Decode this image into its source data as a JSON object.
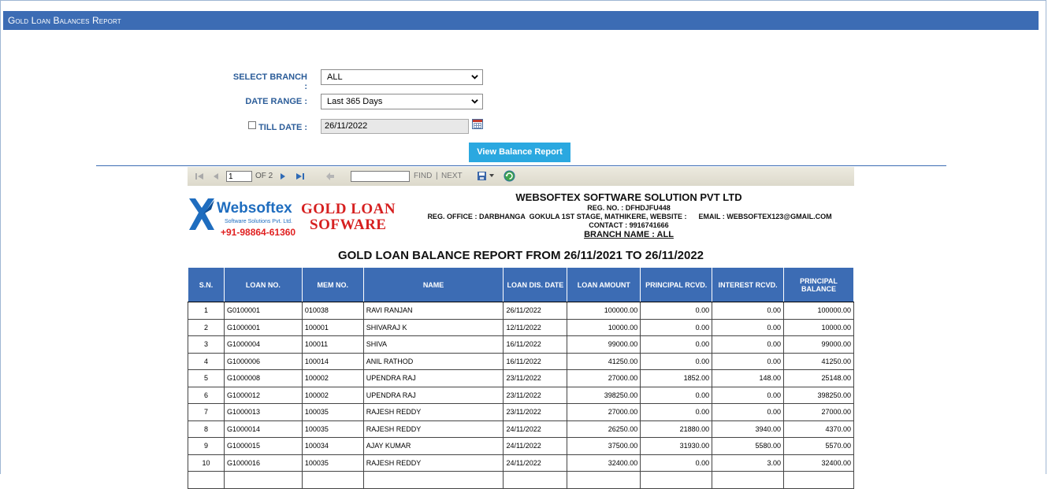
{
  "window": {
    "title": "Gold Loan Balances Report"
  },
  "form": {
    "branch_label": "SELECT BRANCH :",
    "branch_value": "ALL",
    "range_label": "DATE RANGE :",
    "range_value": "Last 365 Days",
    "till_label": "TILL DATE :",
    "till_value": "26/11/2022",
    "submit_label": "View Balance Report"
  },
  "toolbar": {
    "page_value": "1",
    "page_of": "OF 2",
    "find_label": "FIND",
    "sep": "|",
    "next_label": "NEXT"
  },
  "company": {
    "logo_name": "Websoftex",
    "logo_sub": "Software Solutions Pvt. Ltd.",
    "logo_phone": "+91-98864-61360",
    "product_line1": "GOLD LOAN",
    "product_line2": "SOFWARE",
    "name": "WEBSOFTEX SOFTWARE SOLUTION PVT LTD",
    "reg_no": "REG. NO. : DFHDJFU448",
    "office": "REG. OFFICE : DARBHANGA  GOKULA 1ST STAGE, MATHIKERE, WEBSITE :      EMAIL : WEBSOFTEX123@GMAIL.COM",
    "contact": "CONTACT : 9916741666",
    "branch": "BRANCH NAME : ALL"
  },
  "report_title": "GOLD LOAN BALANCE REPORT FROM 26/11/2021 TO 26/11/2022",
  "table": {
    "headers": [
      "S.N.",
      "LOAN NO.",
      "MEM NO.",
      "NAME",
      "LOAN DIS. DATE",
      "LOAN AMOUNT",
      "PRINCIPAL RCVD.",
      "INTEREST RCVD.",
      "PRINCIPAL BALANCE"
    ],
    "rows": [
      [
        "1",
        "G0100001",
        "010038",
        "RAVI  RANJAN",
        "26/11/2022",
        "100000.00",
        "0.00",
        "0.00",
        "100000.00"
      ],
      [
        "2",
        "G1000001",
        "100001",
        "SHIVARAJ K",
        "12/11/2022",
        "10000.00",
        "0.00",
        "0.00",
        "10000.00"
      ],
      [
        "3",
        "G1000004",
        "100011",
        "SHIVA",
        "16/11/2022",
        "99000.00",
        "0.00",
        "0.00",
        "99000.00"
      ],
      [
        "4",
        "G1000006",
        "100014",
        "ANIL RATHOD",
        "16/11/2022",
        "41250.00",
        "0.00",
        "0.00",
        "41250.00"
      ],
      [
        "5",
        "G1000008",
        "100002",
        "UPENDRA RAJ",
        "23/11/2022",
        "27000.00",
        "1852.00",
        "148.00",
        "25148.00"
      ],
      [
        "6",
        "G1000012",
        "100002",
        "UPENDRA RAJ",
        "23/11/2022",
        "398250.00",
        "0.00",
        "0.00",
        "398250.00"
      ],
      [
        "7",
        "G1000013",
        "100035",
        "RAJESH REDDY",
        "23/11/2022",
        "27000.00",
        "0.00",
        "0.00",
        "27000.00"
      ],
      [
        "8",
        "G1000014",
        "100035",
        "RAJESH REDDY",
        "24/11/2022",
        "26250.00",
        "21880.00",
        "3940.00",
        "4370.00"
      ],
      [
        "9",
        "G1000015",
        "100034",
        "AJAY  KUMAR",
        "24/11/2022",
        "37500.00",
        "31930.00",
        "5580.00",
        "5570.00"
      ],
      [
        "10",
        "G1000016",
        "100035",
        "RAJESH REDDY",
        "24/11/2022",
        "32400.00",
        "0.00",
        "3.00",
        "32400.00"
      ],
      [
        "",
        "",
        "",
        "",
        "",
        "",
        "",
        "",
        ""
      ]
    ]
  }
}
